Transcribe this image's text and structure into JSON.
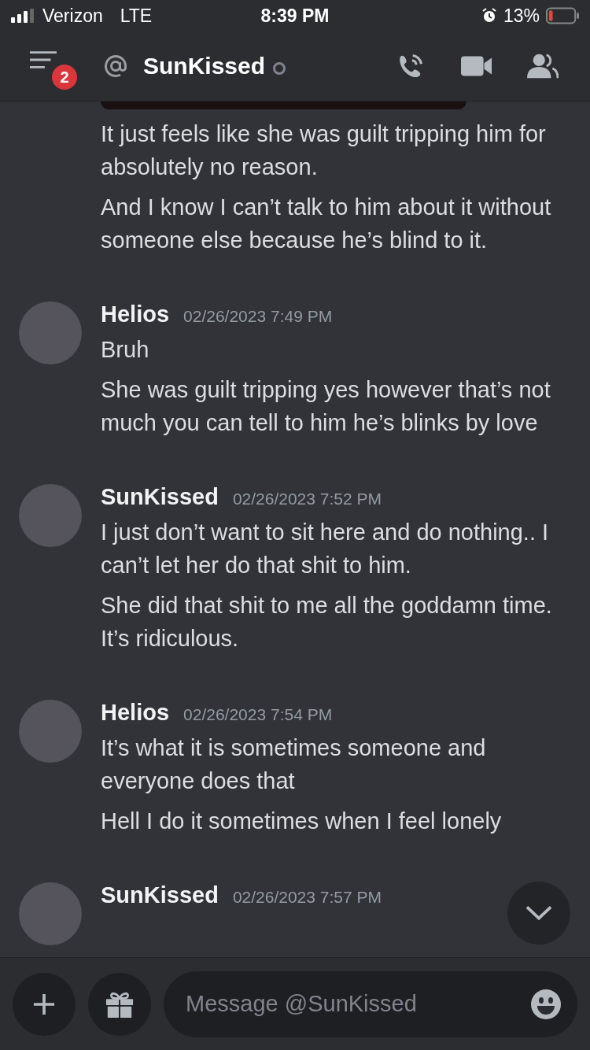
{
  "status_bar": {
    "carrier": "Verizon",
    "network": "LTE",
    "time": "8:39 PM",
    "battery": "13%"
  },
  "header": {
    "badge": "2",
    "title": "SunKissed"
  },
  "messages": [
    {
      "has_image": true,
      "paragraphs": [
        "It just feels like she was guilt tripping him for absolutely no reason.",
        "And I know I can’t talk to him about it without someone else because he’s blind to it."
      ]
    },
    {
      "author": "Helios",
      "timestamp": "02/26/2023 7:49 PM",
      "has_image": false,
      "paragraphs": [
        "Bruh",
        "She was guilt tripping yes however that’s not much you can tell to him he’s blinks by love"
      ]
    },
    {
      "author": "SunKissed",
      "timestamp": "02/26/2023 7:52 PM",
      "has_image": false,
      "paragraphs": [
        "I just don’t want to sit here and do nothing.. I can’t let her do that shit to him.",
        "She did that shit to me all the goddamn time. It’s ridiculous."
      ]
    },
    {
      "author": "Helios",
      "timestamp": "02/26/2023 7:54 PM",
      "has_image": false,
      "paragraphs": [
        "It’s what it is sometimes someone and everyone does that",
        "Hell I do it sometimes when I feel lonely"
      ]
    },
    {
      "author": "SunKissed",
      "timestamp": "02/26/2023 7:57 PM",
      "has_image": false
    }
  ],
  "composer": {
    "placeholder": "Message @SunKissed"
  }
}
